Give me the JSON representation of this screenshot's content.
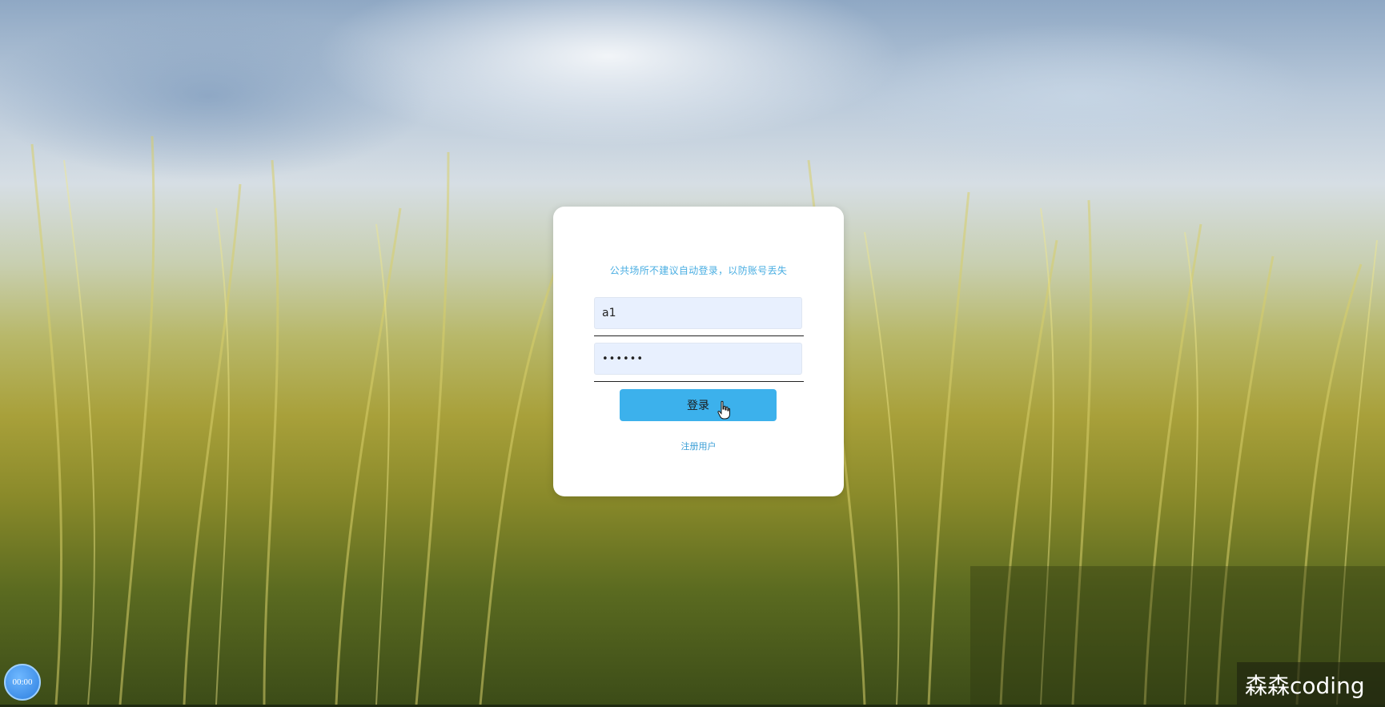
{
  "login": {
    "notice": "公共场所不建议自动登录，以防账号丢失",
    "username_value": "a1",
    "password_value": "••••••",
    "login_button": "登录",
    "register_link": "注册用户"
  },
  "overlay": {
    "timer": "00:00",
    "watermark": "森森coding"
  },
  "colors": {
    "accent": "#3cb1ec",
    "notice": "#4aaee2",
    "input_bg": "#e8f0fe"
  }
}
